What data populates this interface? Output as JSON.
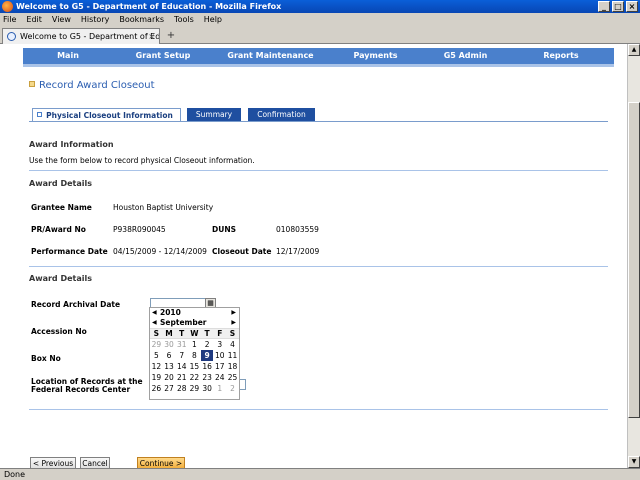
{
  "window": {
    "title": "Welcome to G5 - Department of Education - Mozilla Firefox"
  },
  "menu": [
    "File",
    "Edit",
    "View",
    "History",
    "Bookmarks",
    "Tools",
    "Help"
  ],
  "browser_tab": {
    "label": "Welcome to G5 - Department of Edu..."
  },
  "status": "Done",
  "nav": [
    {
      "label": "Main",
      "w": 90
    },
    {
      "label": "Grant Setup",
      "w": 100
    },
    {
      "label": "Grant Maintenance",
      "w": 115
    },
    {
      "label": "Payments",
      "w": 95
    },
    {
      "label": "G5 Admin",
      "w": 85
    },
    {
      "label": "Reports",
      "w": 106
    }
  ],
  "page": {
    "title": "Record Award Closeout",
    "tabs": [
      "Physical Closeout Information",
      "Summary",
      "Confirmation"
    ],
    "award_info_heading": "Award Information",
    "instruction": "Use the form below to record physical Closeout information.",
    "award_details_heading": "Award Details",
    "fields": {
      "grantee_label": "Grantee Name",
      "grantee_value": "Houston Baptist University",
      "pr_label": "PR/Award No",
      "pr_value": "P938R090045",
      "duns_label": "DUNS",
      "duns_value": "010803559",
      "perf_label": "Performance Date",
      "perf_value": "04/15/2009 - 12/14/2009",
      "closeout_label": "Closeout Date",
      "closeout_value": "12/17/2009"
    },
    "form_heading": "Award Details",
    "form": {
      "archival_label": "Record Archival Date",
      "accession_label": "Accession No",
      "box_label": "Box No",
      "location_label_1": "Location of Records at the",
      "location_label_2": "Federal Records Center"
    },
    "buttons": {
      "previous": "< Previous",
      "cancel": "Cancel",
      "continue": "Continue >"
    }
  },
  "calendar": {
    "year": "2010",
    "month": "September",
    "weekdays": [
      "S",
      "M",
      "T",
      "W",
      "T",
      "F",
      "S"
    ],
    "weeks": [
      [
        "29",
        "30",
        "31",
        "1",
        "2",
        "3",
        "4"
      ],
      [
        "5",
        "6",
        "7",
        "8",
        "9",
        "10",
        "11"
      ],
      [
        "12",
        "13",
        "14",
        "15",
        "16",
        "17",
        "18"
      ],
      [
        "19",
        "20",
        "21",
        "22",
        "23",
        "24",
        "25"
      ],
      [
        "26",
        "27",
        "28",
        "29",
        "30",
        "1",
        "2"
      ]
    ],
    "selected": "9"
  }
}
